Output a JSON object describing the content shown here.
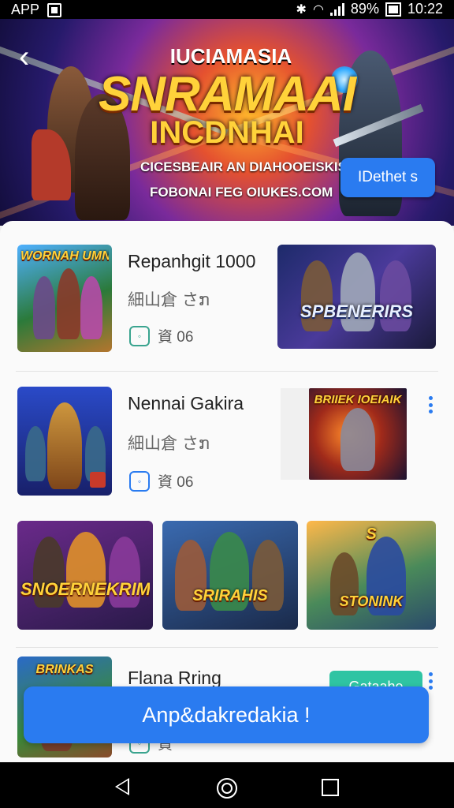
{
  "status_bar": {
    "app_label": "APP",
    "battery": "89%",
    "time": "10:22"
  },
  "banner": {
    "kicker": "IUCIAMASIA",
    "title_line1": "SNRAMAAI",
    "title_line2": "INCDNHAI",
    "subtitle1": "CICESBEAIR AN DIAHOOEISKISA",
    "subtitle2": "FOBONAI FEG OIUKES.COM",
    "button_label": "IDethet s",
    "accent": "#2a7bf0",
    "title_color": "#ffd23a"
  },
  "list": {
    "items": [
      {
        "title": "Repanhgit 1000",
        "subtitle": "細山倉 さກ",
        "meta_icon": "game-badge-icon",
        "meta_text": "資 06",
        "thumb_logo": "WORNAH UMNHALS",
        "side_logo": "SPBENERIRS"
      },
      {
        "title": "Nennai Gakira",
        "subtitle": "細山倉 さກ",
        "meta_icon": "game-badge-icon",
        "meta_text": "資 06",
        "thumb_logo": "",
        "side_logo": "BRIIEK IOEIAIK"
      },
      {
        "title": "Flana Rring",
        "subtitle": "",
        "meta_icon": "game-badge-icon",
        "meta_text": "資",
        "thumb_logo": "BRINKAS",
        "side_logo": ""
      }
    ],
    "grid_logos": [
      "SNOERNEKRIMS",
      "SRIRAHIS",
      "STONINK"
    ],
    "pill_label": "Gataahe"
  },
  "cta": {
    "label": "Anp&dakredakia !",
    "color": "#2a7bf0"
  }
}
